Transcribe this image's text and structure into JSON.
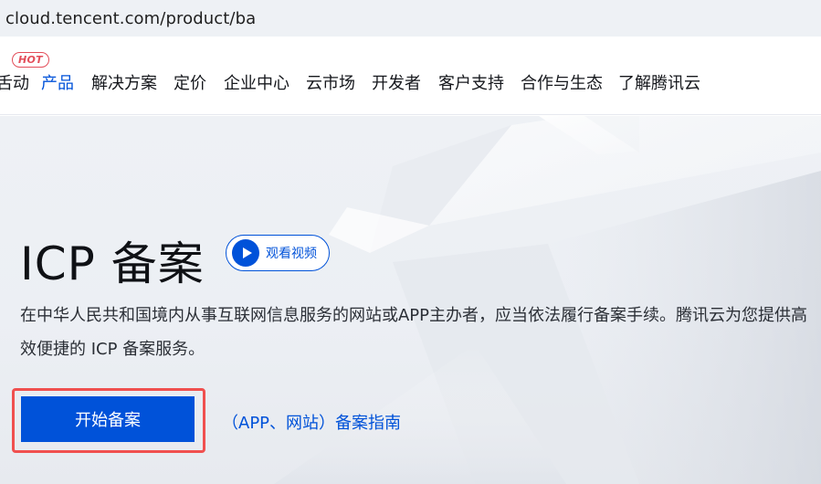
{
  "browser": {
    "url": "cloud.tencent.com/product/ba"
  },
  "nav": {
    "items": [
      {
        "label": "活动",
        "visible_text": "舌动"
      },
      {
        "label": "产品",
        "badge": "HOT",
        "active": true
      },
      {
        "label": "解决方案"
      },
      {
        "label": "定价"
      },
      {
        "label": "企业中心"
      },
      {
        "label": "云市场"
      },
      {
        "label": "开发者"
      },
      {
        "label": "客户支持"
      },
      {
        "label": "合作与生态"
      },
      {
        "label": "了解腾讯云"
      }
    ],
    "active_color": "#0052d9",
    "badge_color": "#e34d59"
  },
  "hero": {
    "title": "ICP 备案",
    "video_button": {
      "label": "观看视频",
      "icon": "play-icon"
    },
    "description": "在中华人民共和国境内从事互联网信息服务的网站或APP主办者，应当依法履行备案手续。腾讯云为您提供高效便捷的 ICP 备案服务。",
    "cta_button": "开始备案",
    "guide_link": "（APP、网站）备案指南"
  },
  "colors": {
    "primary": "#0052d9",
    "highlight": "#f0504f"
  }
}
